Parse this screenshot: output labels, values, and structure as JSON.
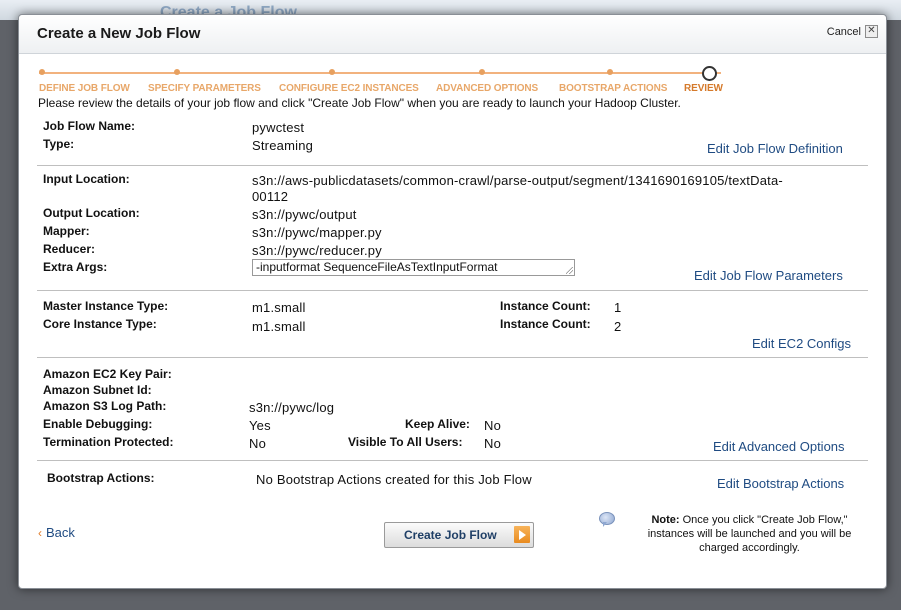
{
  "background_title": "Create a Job Flow",
  "modal": {
    "title": "Create a New Job Flow",
    "cancel_label": "Cancel",
    "close_glyph": "✕"
  },
  "steps": [
    {
      "label": "DEFINE JOB FLOW",
      "state": "done"
    },
    {
      "label": "SPECIFY PARAMETERS",
      "state": "done"
    },
    {
      "label": "CONFIGURE EC2 INSTANCES",
      "state": "done"
    },
    {
      "label": "ADVANCED OPTIONS",
      "state": "done"
    },
    {
      "label": "BOOTSTRAP ACTIONS",
      "state": "done"
    },
    {
      "label": "REVIEW",
      "state": "current"
    }
  ],
  "intro": "Please review the details of your job flow and click \"Create Job Flow\" when you are ready to launch your Hadoop Cluster.",
  "job_flow": {
    "name_label": "Job Flow Name:",
    "name_value": "pywctest",
    "type_label": "Type:",
    "type_value": "Streaming",
    "edit_label": "Edit Job Flow Definition"
  },
  "parameters": {
    "input_label": "Input Location:",
    "input_value_line1": "s3n://aws-publicdatasets/common-crawl/parse-output/segment/1341690169105/textData-",
    "input_value_line2": "00112",
    "output_label": "Output Location:",
    "output_value": "s3n://pywc/output",
    "mapper_label": "Mapper:",
    "mapper_value": "s3n://pywc/mapper.py",
    "reducer_label": "Reducer:",
    "reducer_value": "s3n://pywc/reducer.py",
    "extra_args_label": "Extra Args:",
    "extra_args_value": "-inputformat SequenceFileAsTextInputFormat",
    "edit_label": "Edit Job Flow Parameters"
  },
  "ec2": {
    "master_label": "Master Instance Type:",
    "master_value": "m1.small",
    "master_count_label": "Instance Count:",
    "master_count_value": "1",
    "core_label": "Core Instance Type:",
    "core_value": "m1.small",
    "core_count_label": "Instance Count:",
    "core_count_value": "2",
    "edit_label": "Edit EC2 Configs"
  },
  "advanced": {
    "keypair_label": "Amazon EC2 Key Pair:",
    "subnet_label": "Amazon Subnet Id:",
    "logpath_label": "Amazon S3 Log Path:",
    "logpath_value": "s3n://pywc/log",
    "debug_label": "Enable Debugging:",
    "debug_value": "Yes",
    "keepalive_label": "Keep Alive:",
    "keepalive_value": "No",
    "termprot_label": "Termination Protected:",
    "termprot_value": "No",
    "visible_label": "Visible To All Users:",
    "visible_value": "No",
    "edit_label": "Edit Advanced Options"
  },
  "bootstrap": {
    "label": "Bootstrap Actions:",
    "value": "No Bootstrap Actions created for this Job Flow",
    "edit_label": "Edit Bootstrap Actions"
  },
  "footer": {
    "back_glyph": "‹",
    "back_label": "Back",
    "create_label": "Create Job Flow",
    "note_bold": "Note:",
    "note_text": " Once you click \"Create Job Flow,\" instances will be launched and you will be charged accordingly."
  }
}
